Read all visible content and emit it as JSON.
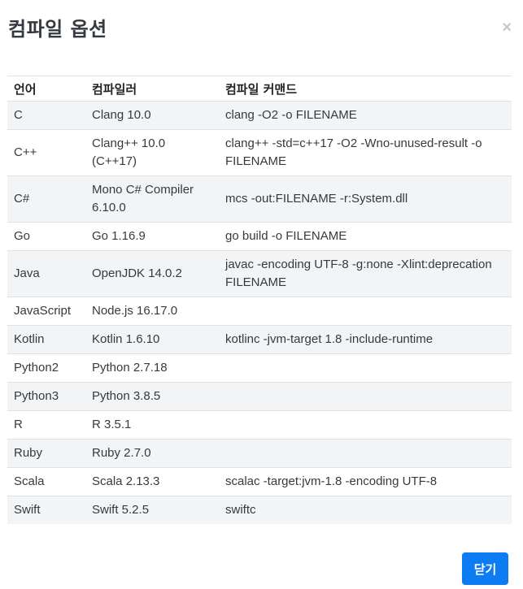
{
  "modal": {
    "title": "컴파일 옵션",
    "close_icon": "×",
    "close_button_label": "닫기"
  },
  "table": {
    "headers": [
      "언어",
      "컴파일러",
      "컴파일 커맨드"
    ],
    "rows": [
      {
        "language": "C",
        "compiler": "Clang 10.0",
        "command": "clang -O2 -o FILENAME"
      },
      {
        "language": "C++",
        "compiler": "Clang++ 10.0 (C++17)",
        "command": "clang++ -std=c++17 -O2 -Wno-unused-result -o FILENAME"
      },
      {
        "language": "C#",
        "compiler": "Mono C# Compiler 6.10.0",
        "command": "mcs -out:FILENAME -r:System.dll"
      },
      {
        "language": "Go",
        "compiler": "Go 1.16.9",
        "command": "go build -o FILENAME"
      },
      {
        "language": "Java",
        "compiler": "OpenJDK 14.0.2",
        "command": "javac -encoding UTF-8 -g:none -Xlint:deprecation FILENAME"
      },
      {
        "language": "JavaScript",
        "compiler": "Node.js 16.17.0",
        "command": ""
      },
      {
        "language": "Kotlin",
        "compiler": "Kotlin 1.6.10",
        "command": "kotlinc -jvm-target 1.8 -include-runtime"
      },
      {
        "language": "Python2",
        "compiler": "Python 2.7.18",
        "command": ""
      },
      {
        "language": "Python3",
        "compiler": "Python 3.8.5",
        "command": ""
      },
      {
        "language": "R",
        "compiler": "R 3.5.1",
        "command": ""
      },
      {
        "language": "Ruby",
        "compiler": "Ruby 2.7.0",
        "command": ""
      },
      {
        "language": "Scala",
        "compiler": "Scala 2.13.3",
        "command": "scalac -target:jvm-1.8 -encoding UTF-8"
      },
      {
        "language": "Swift",
        "compiler": "Swift 5.2.5",
        "command": "swiftc"
      }
    ]
  }
}
